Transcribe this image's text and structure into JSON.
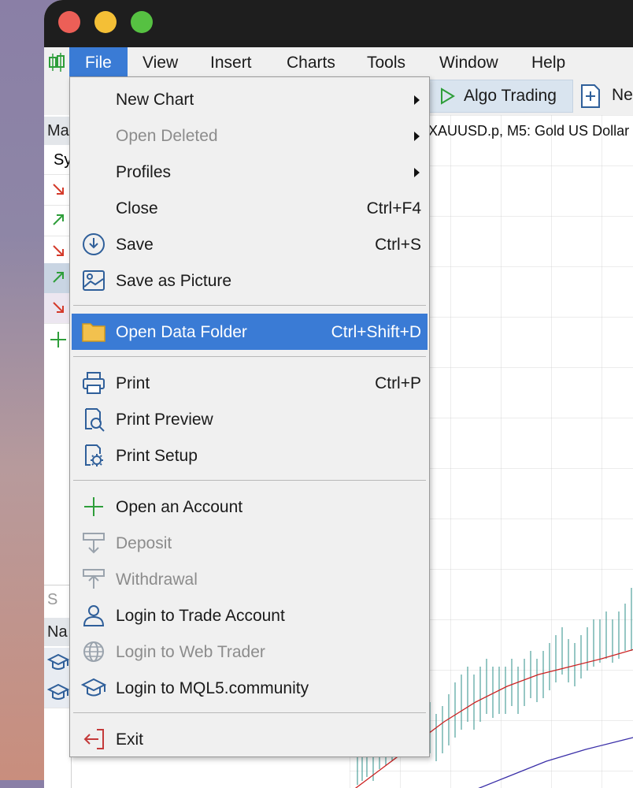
{
  "menubar": {
    "items": [
      "File",
      "View",
      "Insert",
      "Charts",
      "Tools",
      "Window",
      "Help"
    ],
    "active": "File"
  },
  "toolbar": {
    "algo_trading": "Algo Trading",
    "new_order_partial": "Ne"
  },
  "sidebar": {
    "market_watch_head": "Ma",
    "symbol_head": "Sy",
    "navigator_tab": "S",
    "navigator_head": "Na"
  },
  "chart": {
    "title": "XAUUSD.p, M5:  Gold US Dollar"
  },
  "file_menu": {
    "items": [
      {
        "label": "New Chart",
        "submenu": true,
        "enabled": true
      },
      {
        "label": "Open Deleted",
        "submenu": true,
        "enabled": false
      },
      {
        "label": "Profiles",
        "submenu": true,
        "enabled": true
      },
      {
        "label": "Close",
        "shortcut": "Ctrl+F4",
        "enabled": true
      },
      {
        "label": "Save",
        "shortcut": "Ctrl+S",
        "icon": "save-icon",
        "enabled": true
      },
      {
        "label": "Save as Picture",
        "icon": "picture-icon",
        "enabled": true
      },
      {
        "label": "Open Data Folder",
        "shortcut": "Ctrl+Shift+D",
        "icon": "folder-icon",
        "enabled": true,
        "highlighted": true
      },
      {
        "label": "Print",
        "shortcut": "Ctrl+P",
        "icon": "printer-icon",
        "enabled": true
      },
      {
        "label": "Print Preview",
        "icon": "print-preview-icon",
        "enabled": true
      },
      {
        "label": "Print Setup",
        "icon": "print-setup-icon",
        "enabled": true
      },
      {
        "label": "Open an Account",
        "icon": "plus-icon",
        "enabled": true
      },
      {
        "label": "Deposit",
        "icon": "deposit-icon",
        "enabled": false
      },
      {
        "label": "Withdrawal",
        "icon": "withdrawal-icon",
        "enabled": false
      },
      {
        "label": "Login to Trade Account",
        "icon": "user-icon",
        "enabled": true
      },
      {
        "label": "Login to Web Trader",
        "icon": "globe-icon",
        "enabled": false
      },
      {
        "label": "Login to MQL5.community",
        "icon": "graduation-cap-icon",
        "enabled": true
      },
      {
        "label": "Exit",
        "icon": "exit-icon",
        "enabled": true
      }
    ]
  },
  "colors": {
    "highlight": "#3a7bd5",
    "menu_bg": "#f0f0f0",
    "disabled_text": "#8c8c8c"
  }
}
